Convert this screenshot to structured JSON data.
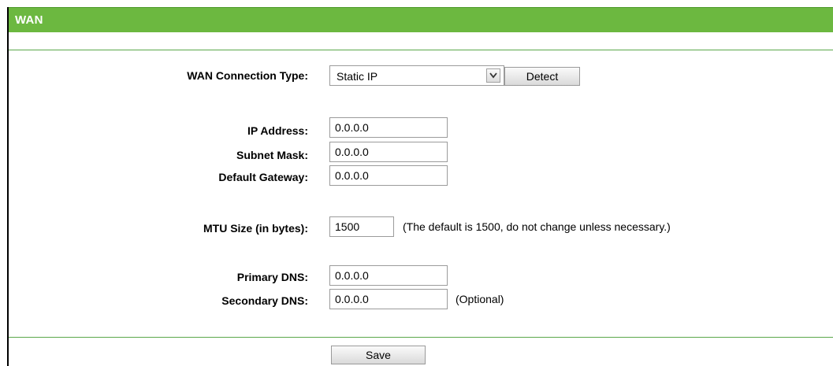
{
  "header": {
    "title": "WAN"
  },
  "wan": {
    "connection_type_label": "WAN Connection Type:",
    "connection_type_value": "Static IP",
    "detect_label": "Detect"
  },
  "ip": {
    "ip_address_label": "IP Address:",
    "ip_address_value": "0.0.0.0",
    "subnet_mask_label": "Subnet Mask:",
    "subnet_mask_value": "0.0.0.0",
    "gateway_label": "Default Gateway:",
    "gateway_value": "0.0.0.0"
  },
  "mtu": {
    "label": "MTU Size (in bytes):",
    "value": "1500",
    "note": "(The default is 1500, do not change unless necessary.)"
  },
  "dns": {
    "primary_label": "Primary DNS:",
    "primary_value": "0.0.0.0",
    "secondary_label": "Secondary DNS:",
    "secondary_value": "0.0.0.0",
    "secondary_note": "(Optional)"
  },
  "footer": {
    "save_label": "Save"
  },
  "colors": {
    "header_green": "#6cb840",
    "divider_green": "#5aa84a"
  },
  "icons": {
    "select_arrow": "chevron-down-icon"
  }
}
